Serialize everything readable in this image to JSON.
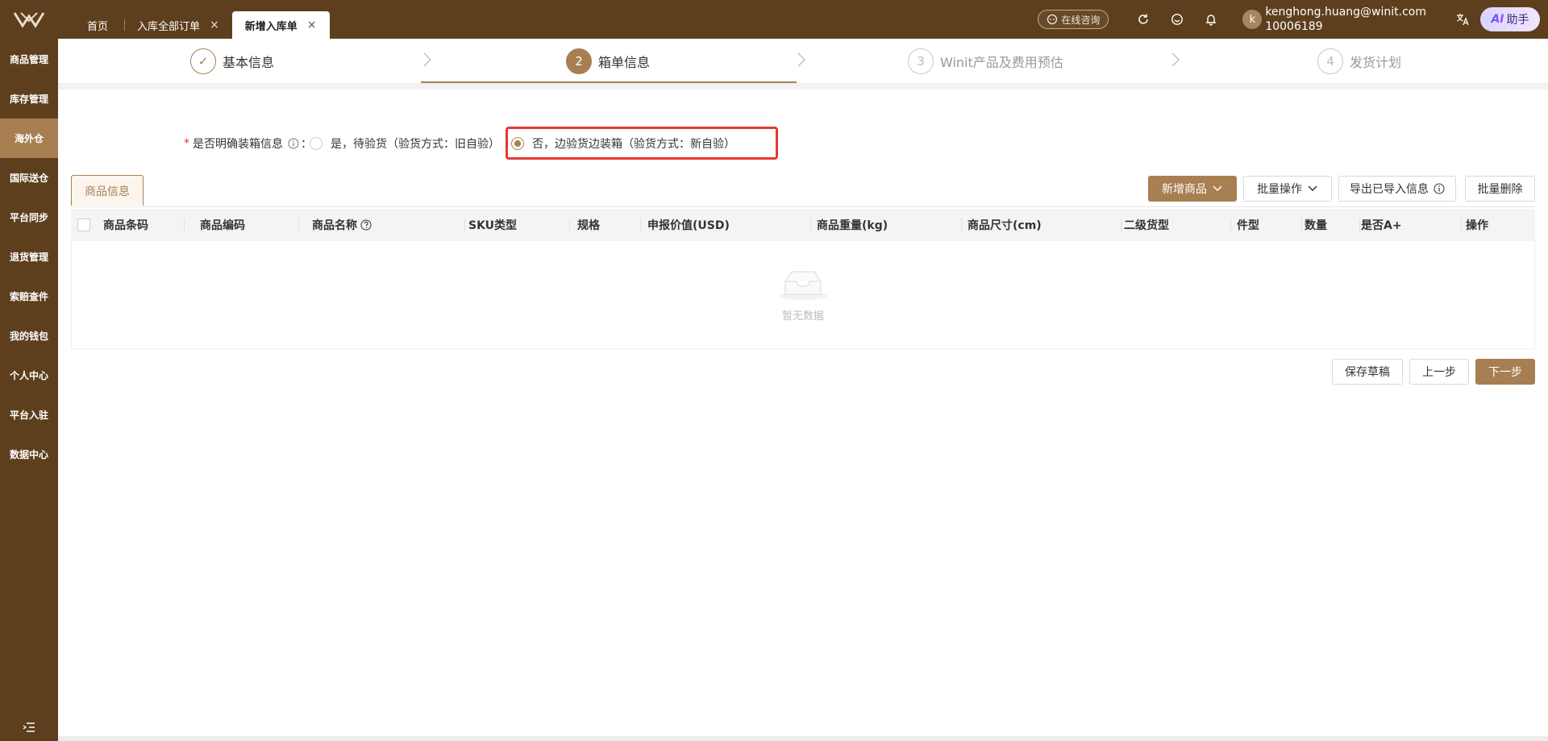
{
  "topbar": {
    "tabs": [
      {
        "label": "首页",
        "closable": false
      },
      {
        "label": "入库全部订单",
        "closable": true
      },
      {
        "label": "新增入库单",
        "closable": true,
        "active": true
      }
    ],
    "close_glyph": "×",
    "consult_label": "在线咨询",
    "user": {
      "initial": "k",
      "email": "kenghong.huang@winit.com",
      "id": "10006189"
    },
    "ai": {
      "badge": "AI",
      "label": "助手"
    }
  },
  "sidebar": {
    "items": [
      "商品管理",
      "库存管理",
      "海外仓",
      "国际送仓",
      "平台同步",
      "退货管理",
      "索赔查件",
      "我的钱包",
      "个人中心",
      "平台入驻",
      "数据中心"
    ],
    "active_index": 2
  },
  "steps": [
    {
      "number": "✓",
      "label": "基本信息",
      "state": "done"
    },
    {
      "number": "2",
      "label": "箱单信息",
      "state": "current"
    },
    {
      "number": "3",
      "label": "Winit产品及费用预估",
      "state": "pending"
    },
    {
      "number": "4",
      "label": "发货计划",
      "state": "pending"
    }
  ],
  "form": {
    "question": {
      "required_mark": "*",
      "label": "是否明确装箱信息",
      "colon": "："
    },
    "options": [
      {
        "label": "是，待验货（验货方式：旧自验）",
        "checked": false
      },
      {
        "label": "否，边验货边装箱（验货方式：新自验）",
        "checked": true
      }
    ]
  },
  "section": {
    "tab_label": "商品信息"
  },
  "toolbar": {
    "add_product": "新增商品",
    "batch_ops": "批量操作",
    "export": "导出已导入信息",
    "batch_delete": "批量删除"
  },
  "table": {
    "columns": [
      "商品条码",
      "商品编码",
      "商品名称",
      "SKU类型",
      "规格",
      "申报价值(USD)",
      "商品重量(kg)",
      "商品尺寸(cm)",
      "二级货型",
      "件型",
      "数量",
      "是否A+",
      "操作"
    ],
    "empty_text": "暂无数据"
  },
  "footer": {
    "save_draft": "保存草稿",
    "prev": "上一步",
    "next": "下一步"
  },
  "colors": {
    "brand_dark": "#5e3f1d",
    "brand": "#a87f52",
    "highlight": "#e53935"
  }
}
